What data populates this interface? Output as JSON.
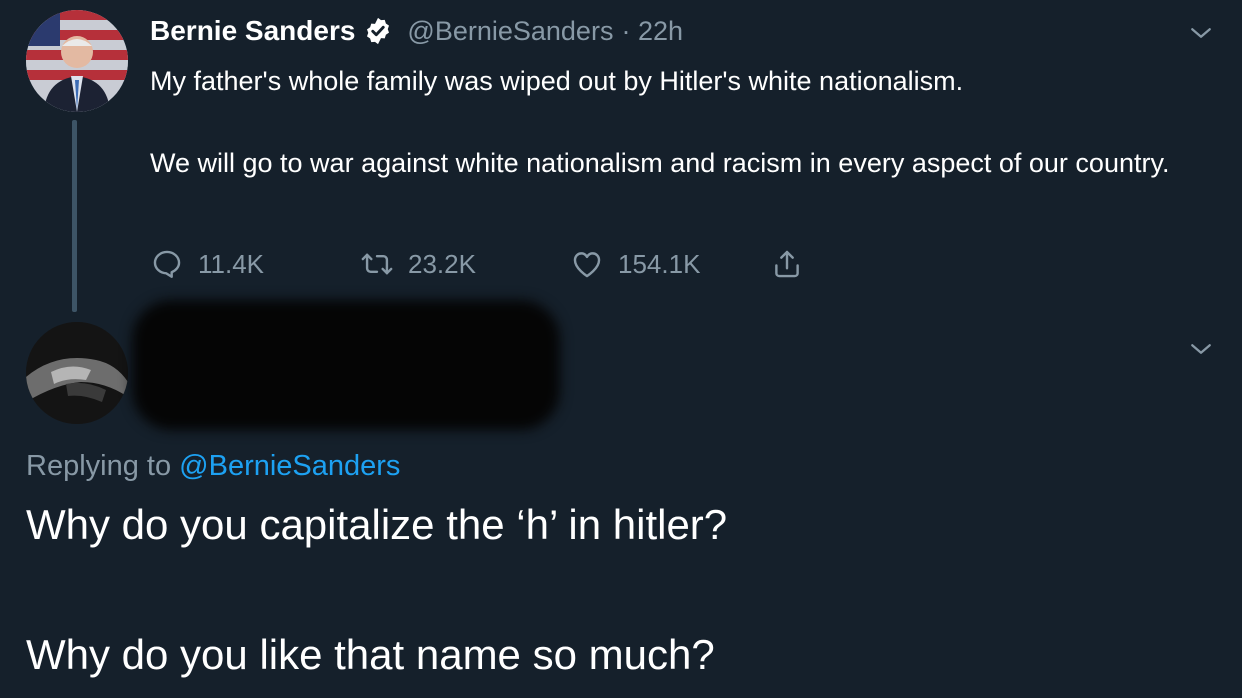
{
  "tweet": {
    "display_name": "Bernie Sanders",
    "handle": "@BernieSanders",
    "time": "· 22h",
    "verified_icon": "verified-badge-icon",
    "text_line1": "My father's whole family was wiped out by Hitler's white nationalism.",
    "text_line2": "We will go to war against white nationalism and racism in every aspect of our country.",
    "stats": {
      "replies": "11.4K",
      "retweets": "23.2K",
      "likes": "154.1K"
    }
  },
  "reply": {
    "replying_prefix": "Replying to",
    "replying_handle": "@BernieSanders",
    "text_line1": "Why do you capitalize the ‘h’ in hitler?",
    "text_line2": "Why do you like that name so much?"
  },
  "colors": {
    "background": "#15202b",
    "secondary_text": "#8899a6",
    "link": "#1da1f2",
    "thread_line": "#3d5466"
  }
}
